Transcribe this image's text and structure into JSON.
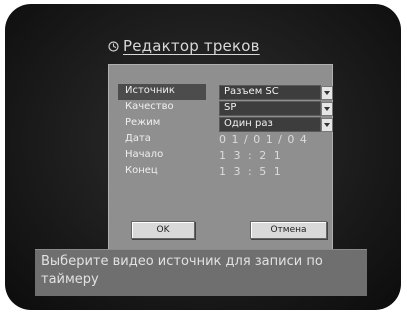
{
  "title": "Редактор треков",
  "fields": [
    {
      "label": "Источник",
      "value": "Разъем SC",
      "type": "dropdown",
      "selected": true
    },
    {
      "label": "Качество",
      "value": "SP",
      "type": "dropdown"
    },
    {
      "label": "Режим",
      "value": "Один раз",
      "type": "dropdown"
    },
    {
      "label": "Дата",
      "value": "0 1 / 0 1 / 0 4",
      "type": "text"
    },
    {
      "label": "Начало",
      "value": "1 3 : 2 1",
      "type": "text"
    },
    {
      "label": "Конец",
      "value": "1 3 : 5 1",
      "type": "text"
    }
  ],
  "buttons": {
    "ok": "OK",
    "cancel": "Отмена"
  },
  "message": "Выберите видео источник для записи по таймеру",
  "icons": {
    "title": "clock-icon"
  }
}
